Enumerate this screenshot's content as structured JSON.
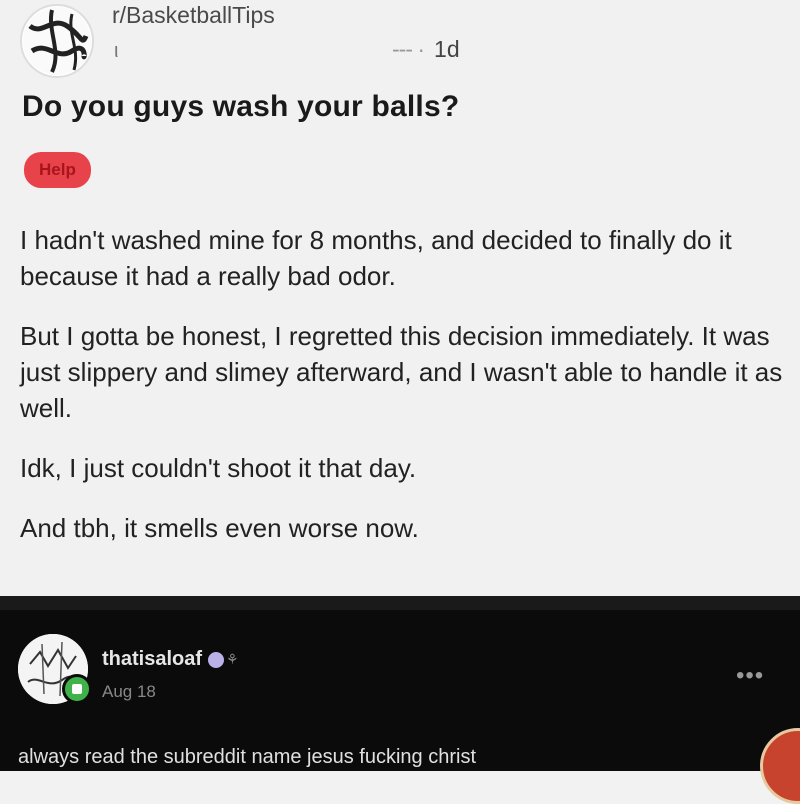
{
  "post": {
    "subreddit": "r/BasketballTips",
    "author_partial": "ι",
    "time": "1d",
    "title": "Do you guys wash your balls?",
    "flair": "Help",
    "paragraphs": [
      "I hadn't washed mine for 8 months, and decided to finally do it because it had a really bad odor.",
      "But I gotta be honest, I regretted this decision immediately. It was just slippery and slimey afterward, and I wasn't able to handle it as well.",
      "Idk, I just couldn't shoot it that day.",
      "And tbh, it smells even worse now."
    ]
  },
  "comment": {
    "username": "thatisaloaf",
    "date": "Aug 18",
    "more_label": "•••",
    "text": "always read the subreddit name jesus fucking christ"
  },
  "colors": {
    "flair_bg": "#e8424b",
    "online_dot": "#3fb24a",
    "comment_bg": "#0b0b0b"
  }
}
